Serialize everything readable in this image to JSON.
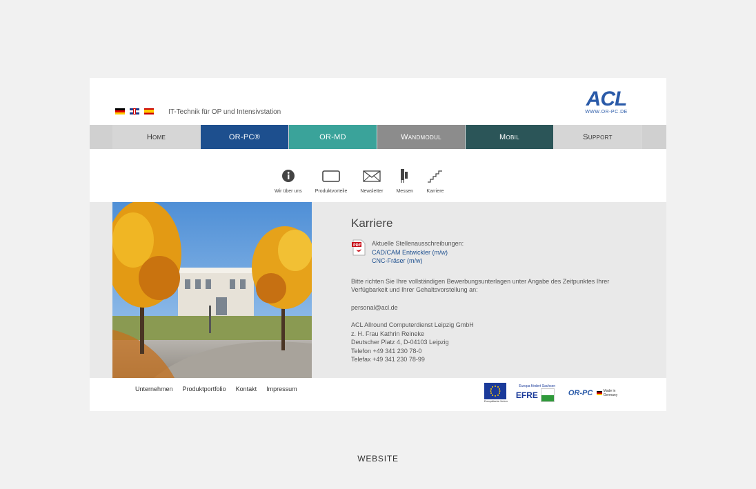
{
  "header": {
    "tagline": "IT-Technik für OP und Intensivstation",
    "logo_text": "ACL",
    "logo_url": "WWW.OR-PC.DE",
    "flags": [
      "de",
      "uk",
      "es"
    ]
  },
  "nav": {
    "tabs": [
      {
        "label": "Home",
        "color": "#d6d6d6"
      },
      {
        "label": "OR-PC®",
        "color": "#1d4f8e"
      },
      {
        "label": "OR-MD",
        "color": "#3aa39a"
      },
      {
        "label": "Wandmodul",
        "color": "#8c8c8c"
      },
      {
        "label": "Mobil",
        "color": "#2b5558"
      },
      {
        "label": "Support",
        "color": "#d6d6d6"
      }
    ]
  },
  "subnav": [
    {
      "label": "Wir über uns",
      "icon": "info-icon"
    },
    {
      "label": "Produktvorteile",
      "icon": "monitor-icon"
    },
    {
      "label": "Newsletter",
      "icon": "envelope-icon"
    },
    {
      "label": "Messen",
      "icon": "booth-icon"
    },
    {
      "label": "Karriere",
      "icon": "stairs-icon"
    }
  ],
  "content": {
    "title": "Karriere",
    "jobs_heading": "Aktuelle Stellenausschreibungen:",
    "jobs": [
      "CAD/CAM Entwickler (m/w)",
      "CNC-Fräser (m/w)"
    ],
    "instruction": "Bitte richten Sie Ihre vollständigen Bewerbungsunterlagen unter Angabe des Zeitpunktes Ihrer Verfügbarkeit und Ihrer Gehaltsvorstellung an:",
    "email": "personal@acl.de",
    "address": [
      "ACL Allround Computerdienst Leipzig GmbH",
      "z. H. Frau Kathrin Reineke",
      "Deutscher Platz 4, D-04103 Leipzig",
      "Telefon +49 341 230 78-0",
      "Telefax +49 341 230 78-99"
    ]
  },
  "footer": {
    "links": [
      "Unternehmen",
      "Produktportfolio",
      "Kontakt",
      "Impressum"
    ],
    "eu_caption": "Europäische Union",
    "efre_top": "Europa fördert Sachsen",
    "efre_word": "EFRE",
    "orpc_logo": "OR-PC",
    "made_in": "Made in Germany"
  },
  "caption": "WEBSITE"
}
